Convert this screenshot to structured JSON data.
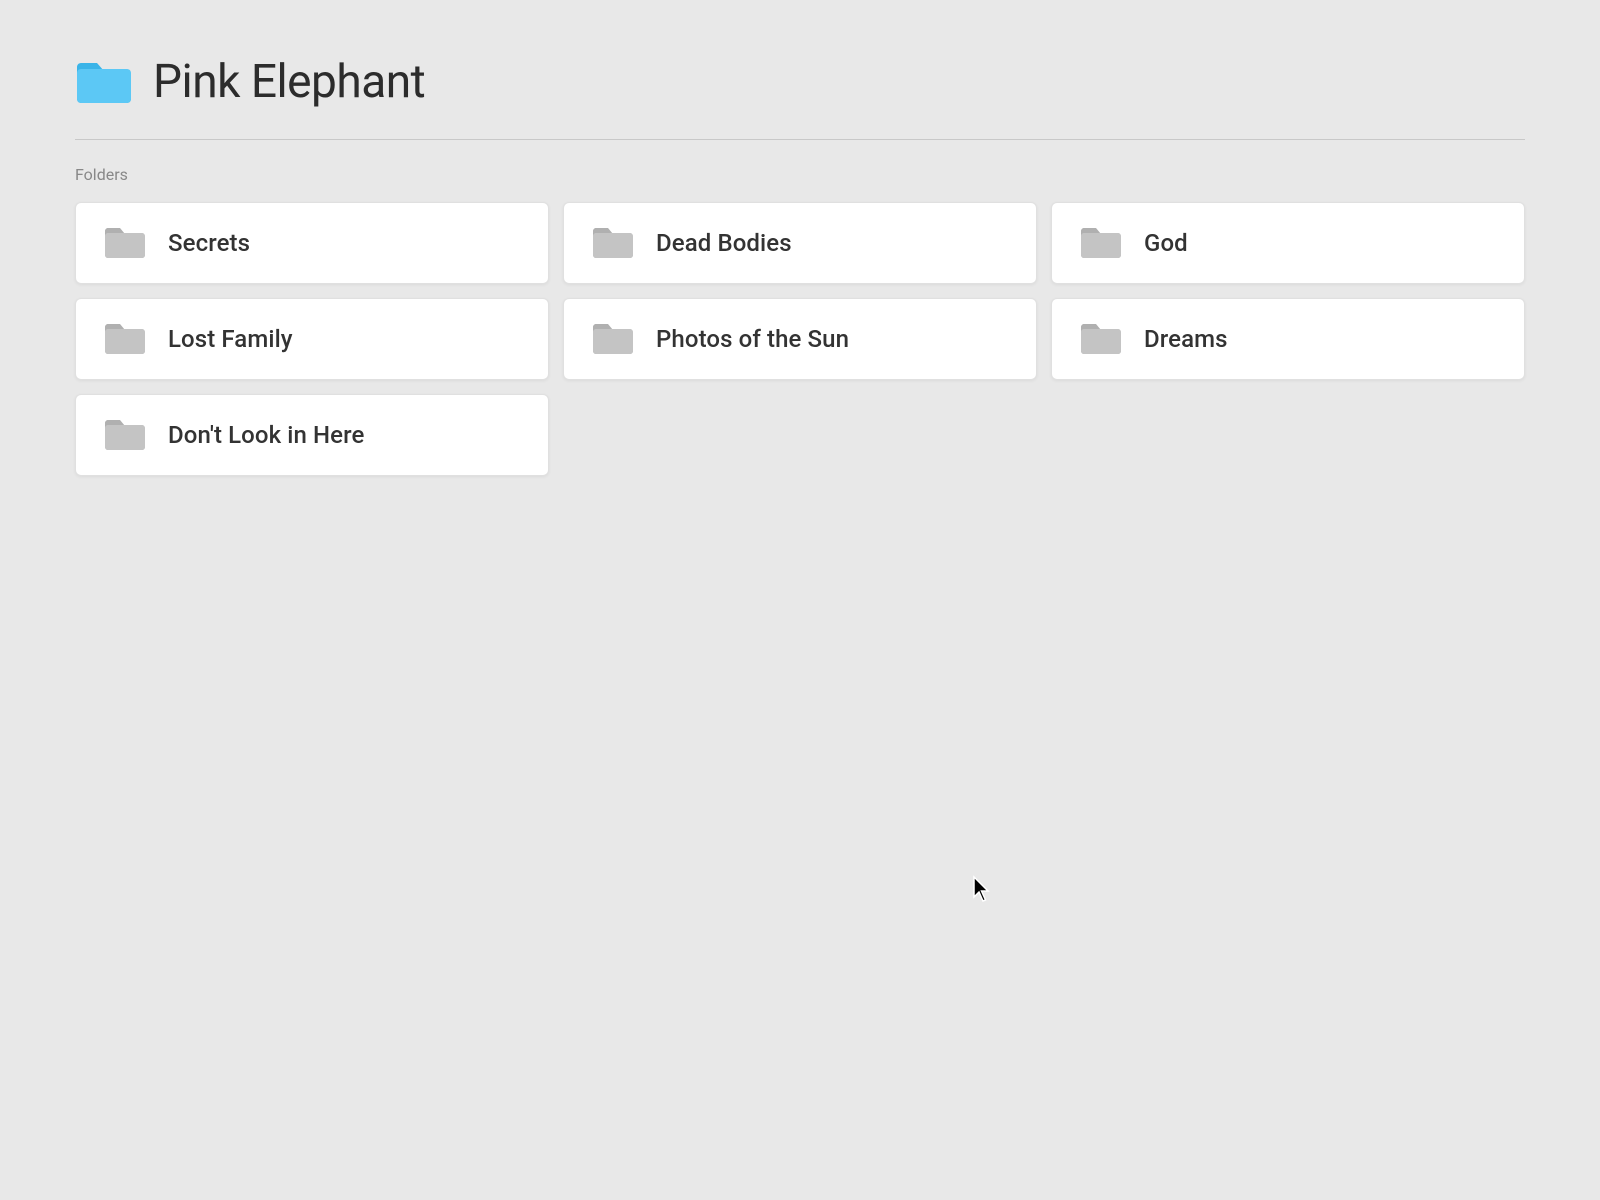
{
  "header": {
    "title": "Pink Elephant",
    "folder_color": "#3ab4e8"
  },
  "sections": {
    "folders_label": "Folders"
  },
  "folders": [
    {
      "id": "secrets",
      "name": "Secrets"
    },
    {
      "id": "dead-bodies",
      "name": "Dead Bodies"
    },
    {
      "id": "god",
      "name": "God"
    },
    {
      "id": "lost-family",
      "name": "Lost Family"
    },
    {
      "id": "photos-of-the-sun",
      "name": "Photos of the Sun"
    },
    {
      "id": "dreams",
      "name": "Dreams"
    },
    {
      "id": "dont-look-in-here",
      "name": "Don't Look in Here"
    }
  ]
}
